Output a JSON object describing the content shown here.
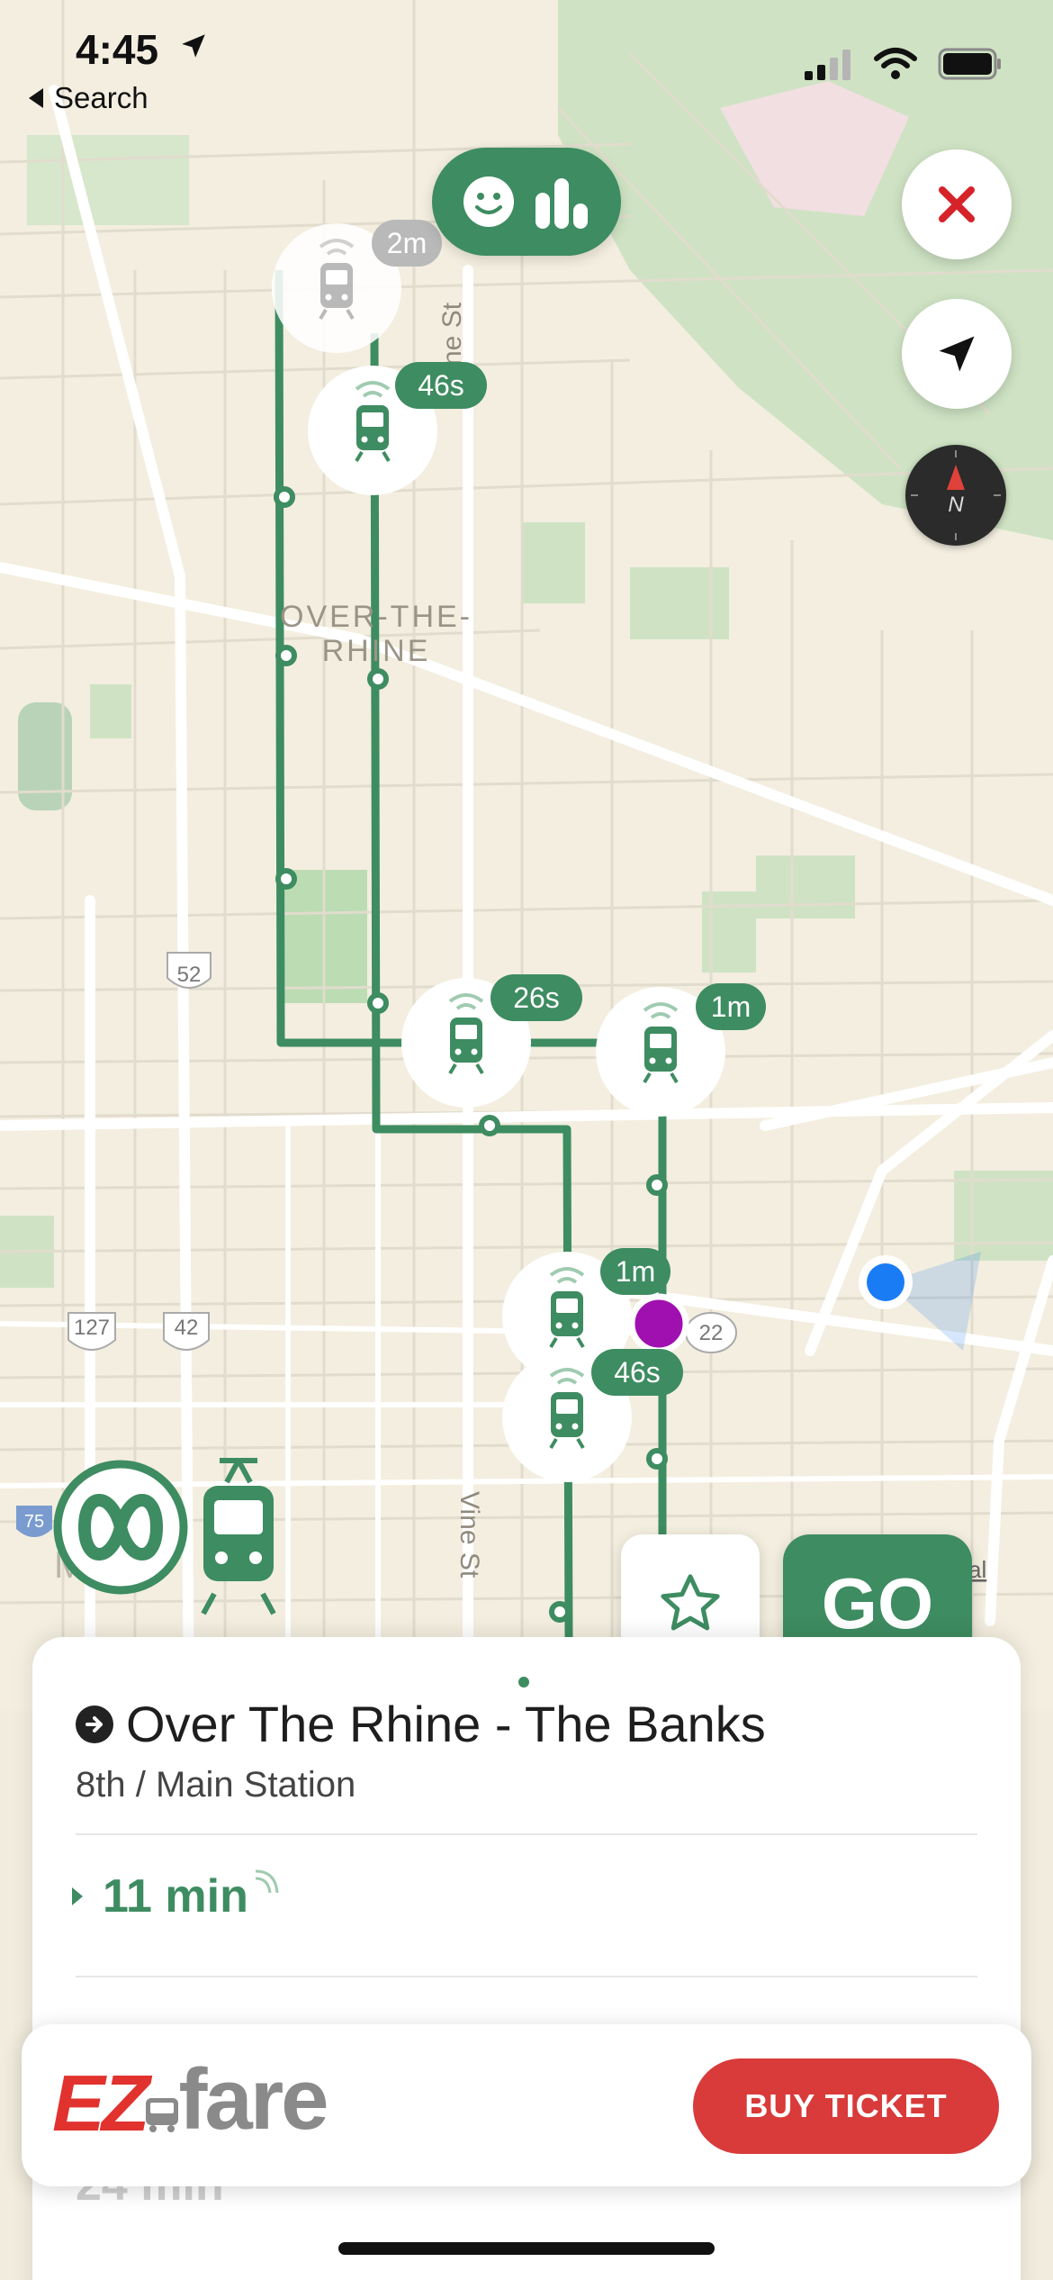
{
  "status_bar": {
    "time": "4:45",
    "back_label": "Search"
  },
  "map": {
    "neighborhood_line1": "OVER-THE-",
    "neighborhood_line2": "RHINE",
    "street_vine_top": "ne St",
    "street_vine_bottom": "Vine St",
    "shield_52": "52",
    "shield_127": "127",
    "shield_42": "42",
    "shield_22": "22",
    "shield_75": "75",
    "maps_watermark": "Maps",
    "legal_label": "al",
    "vehicles": [
      {
        "eta": "2m",
        "stale": true
      },
      {
        "eta": "46s",
        "stale": false
      },
      {
        "eta": "26s",
        "stale": false
      },
      {
        "eta": "1m",
        "stale": false
      },
      {
        "eta": "1m",
        "stale": false
      },
      {
        "eta": "46s",
        "stale": false
      }
    ]
  },
  "buttons": {
    "go_label": "GO"
  },
  "card": {
    "route_name": "Over The Rhine - The Banks",
    "station_name": "8th / Main Station",
    "etas": [
      "11 min",
      "24 min"
    ]
  },
  "ezfare": {
    "logo_ez": "EZ",
    "logo_fare": "fare",
    "buy_label": "BUY TICKET"
  },
  "colors": {
    "route_green": "#3e8c61",
    "buy_red": "#d93a3a",
    "stop_purple": "#a010b0",
    "location_blue": "#1a7cf5"
  }
}
